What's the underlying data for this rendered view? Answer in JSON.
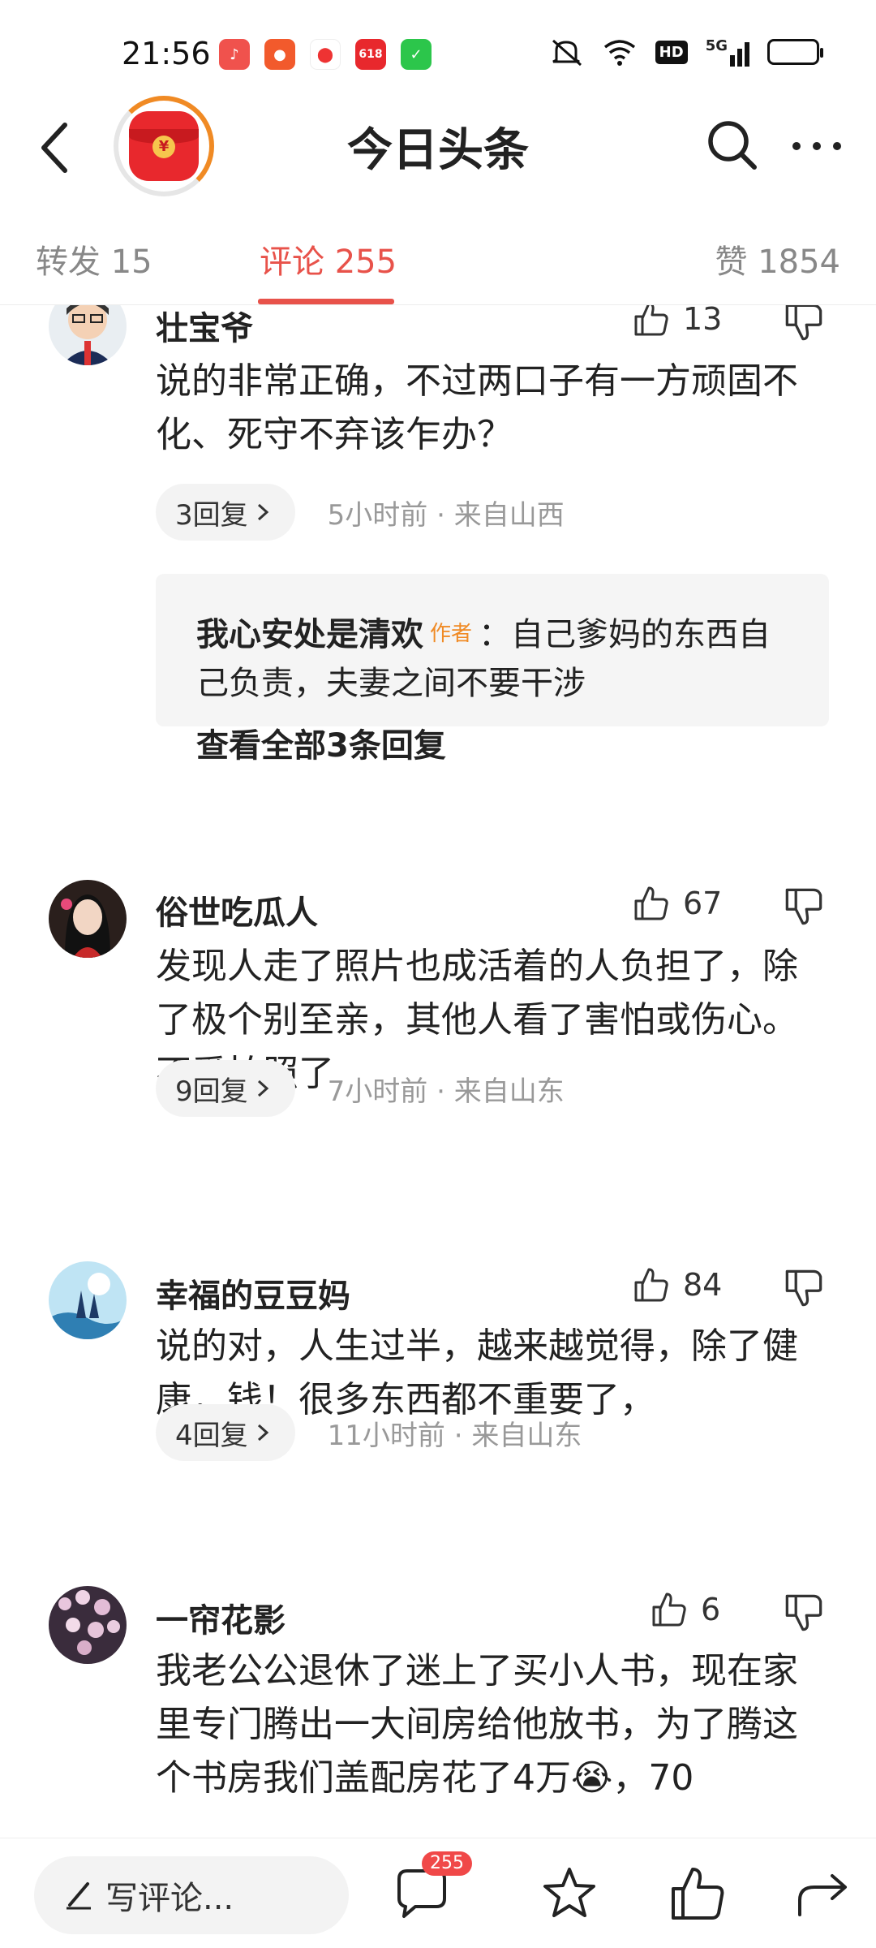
{
  "status_bar": {
    "time": "21:56",
    "app_icons": [
      "music-app-icon",
      "kuaishou-icon",
      "map-pin-icon",
      "618-shopping-icon",
      "green-app-icon"
    ],
    "indicators": [
      "mute-icon",
      "wifi-icon",
      "hd-icon",
      "5g-signal-icon",
      "battery-icon"
    ],
    "network": "5G",
    "hd_label": "HD",
    "app_618_label": "618"
  },
  "header": {
    "title": "今日头条",
    "back_icon": "chevron-left-icon",
    "search_icon": "search-icon",
    "more_icon": "more-dots-icon",
    "accent_color": "#e8524a",
    "red_packet_label": "¥"
  },
  "tabs": [
    {
      "label": "转发 15"
    },
    {
      "label": "评论 255"
    },
    {
      "label": "赞 1854"
    }
  ],
  "comments": [
    {
      "name": "壮宝爷",
      "likes": "13",
      "text": "说的非常正确，不过两口子有一方顽固不化、死守不弃该乍办？",
      "replies_label": "3回复",
      "meta": "5小时前 · 来自山西",
      "reply": {
        "author": "我心安处是清欢",
        "author_tag": "作者",
        "text": "：自己爹妈的东西自己负责，夫妻之间不要干涉",
        "view_all": "查看全部3条回复"
      }
    },
    {
      "name": "俗世吃瓜人",
      "likes": "67",
      "text": "发现人走了照片也成活着的人负担了，除了极个别至亲，其他人看了害怕或伤心。不爱拍照了",
      "replies_label": "9回复",
      "meta": "7小时前 · 来自山东"
    },
    {
      "name": "幸福的豆豆妈",
      "likes": "84",
      "text": "说的对，人生过半，越来越觉得，除了健康，钱！很多东西都不重要了，",
      "replies_label": "4回复",
      "meta": "11小时前 · 来自山东"
    },
    {
      "name": "一帘花影",
      "likes": "6",
      "text": "我老公公退休了迷上了买小人书，现在家里专门腾出一大间房给他放书，为了腾这个书房我们盖配房花了4万😭，70"
    }
  ],
  "bottom_bar": {
    "write_placeholder": "写评论...",
    "comment_count": "255",
    "icons": [
      "pen-icon",
      "comment-icon",
      "star-icon",
      "thumbs-up-icon",
      "share-icon"
    ]
  }
}
